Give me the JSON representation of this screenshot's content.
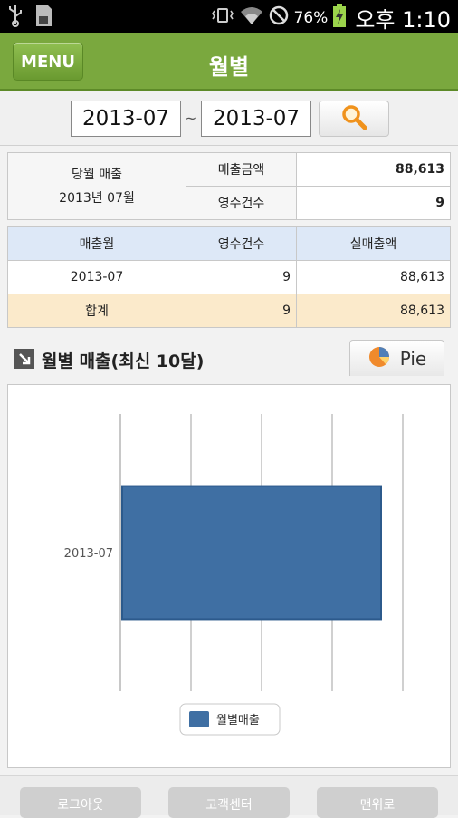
{
  "status_bar": {
    "battery_pct": "76%",
    "time": "오후 1:10",
    "icons": [
      "usb-icon",
      "sd-card-icon",
      "vibrate-icon",
      "wifi-icon",
      "no-signal-icon",
      "battery-charging-icon"
    ]
  },
  "header": {
    "menu_label": "MENU",
    "title": "월별"
  },
  "date_range": {
    "from": "2013-07",
    "separator": "~",
    "to": "2013-07"
  },
  "summary": {
    "label_line1": "당월 매출",
    "label_line2": "2013년 07월",
    "rows": [
      {
        "label": "매출금액",
        "value": "88,613"
      },
      {
        "label": "영수건수",
        "value": "9"
      }
    ]
  },
  "monthly_table": {
    "headers": [
      "매출월",
      "영수건수",
      "실매출액"
    ],
    "rows": [
      {
        "month": "2013-07",
        "count": "9",
        "amount": "88,613"
      }
    ],
    "total": {
      "label": "합계",
      "count": "9",
      "amount": "88,613"
    }
  },
  "chart_section": {
    "title": "월별 매출(최신 10달)",
    "pie_button_label": "Pie"
  },
  "chart_data": {
    "type": "bar",
    "orientation": "horizontal",
    "categories": [
      "2013-07"
    ],
    "series": [
      {
        "name": "월별매출",
        "values": [
          88613
        ],
        "color": "#3f6fa3"
      }
    ],
    "grid": true,
    "legend": "bottom-center"
  },
  "bottom_bar": {
    "logout": "로그아웃",
    "support": "고객센터",
    "top": "맨위로"
  }
}
